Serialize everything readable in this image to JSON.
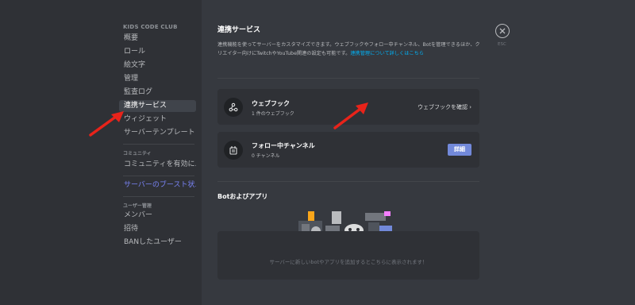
{
  "sidebar": {
    "server_name": "KIDS CODE CLUB",
    "items": [
      {
        "label": "概要"
      },
      {
        "label": "ロール"
      },
      {
        "label": "絵文字"
      },
      {
        "label": "管理"
      },
      {
        "label": "監査ログ"
      },
      {
        "label": "連携サービス"
      },
      {
        "label": "ウィジェット"
      },
      {
        "label": "サーバーテンプレート"
      }
    ],
    "community_section": "コミュニティ",
    "community_items": [
      {
        "label": "コミュニティを有効に..."
      }
    ],
    "boost_item": "サーバーのブースト状...",
    "user_section": "ユーザー管理",
    "user_items": [
      {
        "label": "メンバー"
      },
      {
        "label": "招待"
      },
      {
        "label": "BANしたユーザー"
      }
    ]
  },
  "main": {
    "title": "連携サービス",
    "description": "連携機能を使ってサーバーをカスタマイズできます。ウェブフックやフォロー中チャンネル、Botを管理できるほか、クリエイター向けにTwitchやYouTube関連の設定も可能です。",
    "description_link": "連携管理について詳しくはこちら",
    "webhook": {
      "title": "ウェブフック",
      "subtitle": "1 件のウェブフック",
      "link": "ウェブフックを確認"
    },
    "followed": {
      "title": "フォロー中チャンネル",
      "subtitle": "0 チャンネル",
      "button": "詳細"
    },
    "bots_title": "Botおよびアプリ",
    "bots_empty": "サーバーに新しいbotやアプリを追加するとこちらに表示されます！"
  },
  "close": {
    "label": "ESC"
  },
  "colors": {
    "accent": "#7289da",
    "link": "#00b0f4",
    "arrow": "#e8231a"
  }
}
